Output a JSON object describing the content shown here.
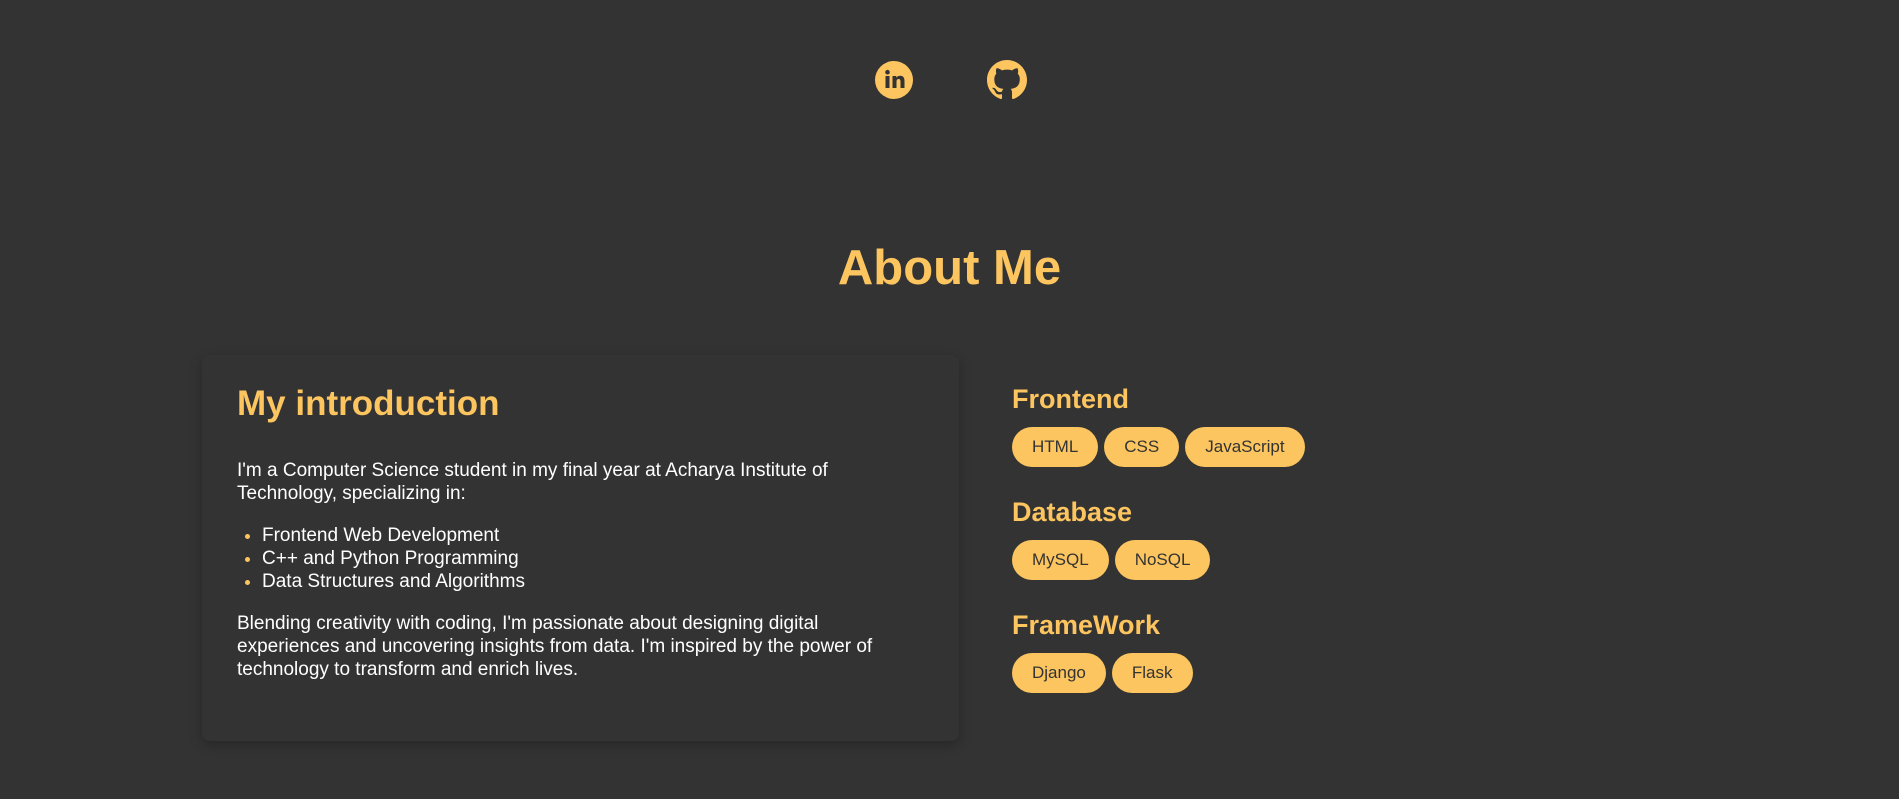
{
  "social": {
    "linkedin_icon": "linkedin-icon",
    "github_icon": "github-icon"
  },
  "about": {
    "title": "About Me"
  },
  "intro": {
    "title": "My introduction",
    "paragraph1": "I'm a Computer Science student in my final year at Acharya Institute of Technology, specializing in:",
    "list": [
      "Frontend Web Development",
      "C++ and Python Programming",
      "Data Structures and Algorithms"
    ],
    "paragraph2": "Blending creativity with coding, I'm passionate about designing digital experiences and uncovering insights from data. I'm inspired by the power of technology to transform and enrich lives."
  },
  "skills": {
    "groups": [
      {
        "heading": "Frontend",
        "items": [
          "HTML",
          "CSS",
          "JavaScript"
        ]
      },
      {
        "heading": "Database",
        "items": [
          "MySQL",
          "NoSQL"
        ]
      },
      {
        "heading": "FrameWork",
        "items": [
          "Django",
          "Flask"
        ]
      }
    ]
  },
  "colors": {
    "background": "#333333",
    "accent": "#fcc55f",
    "text": "#ffffff"
  }
}
